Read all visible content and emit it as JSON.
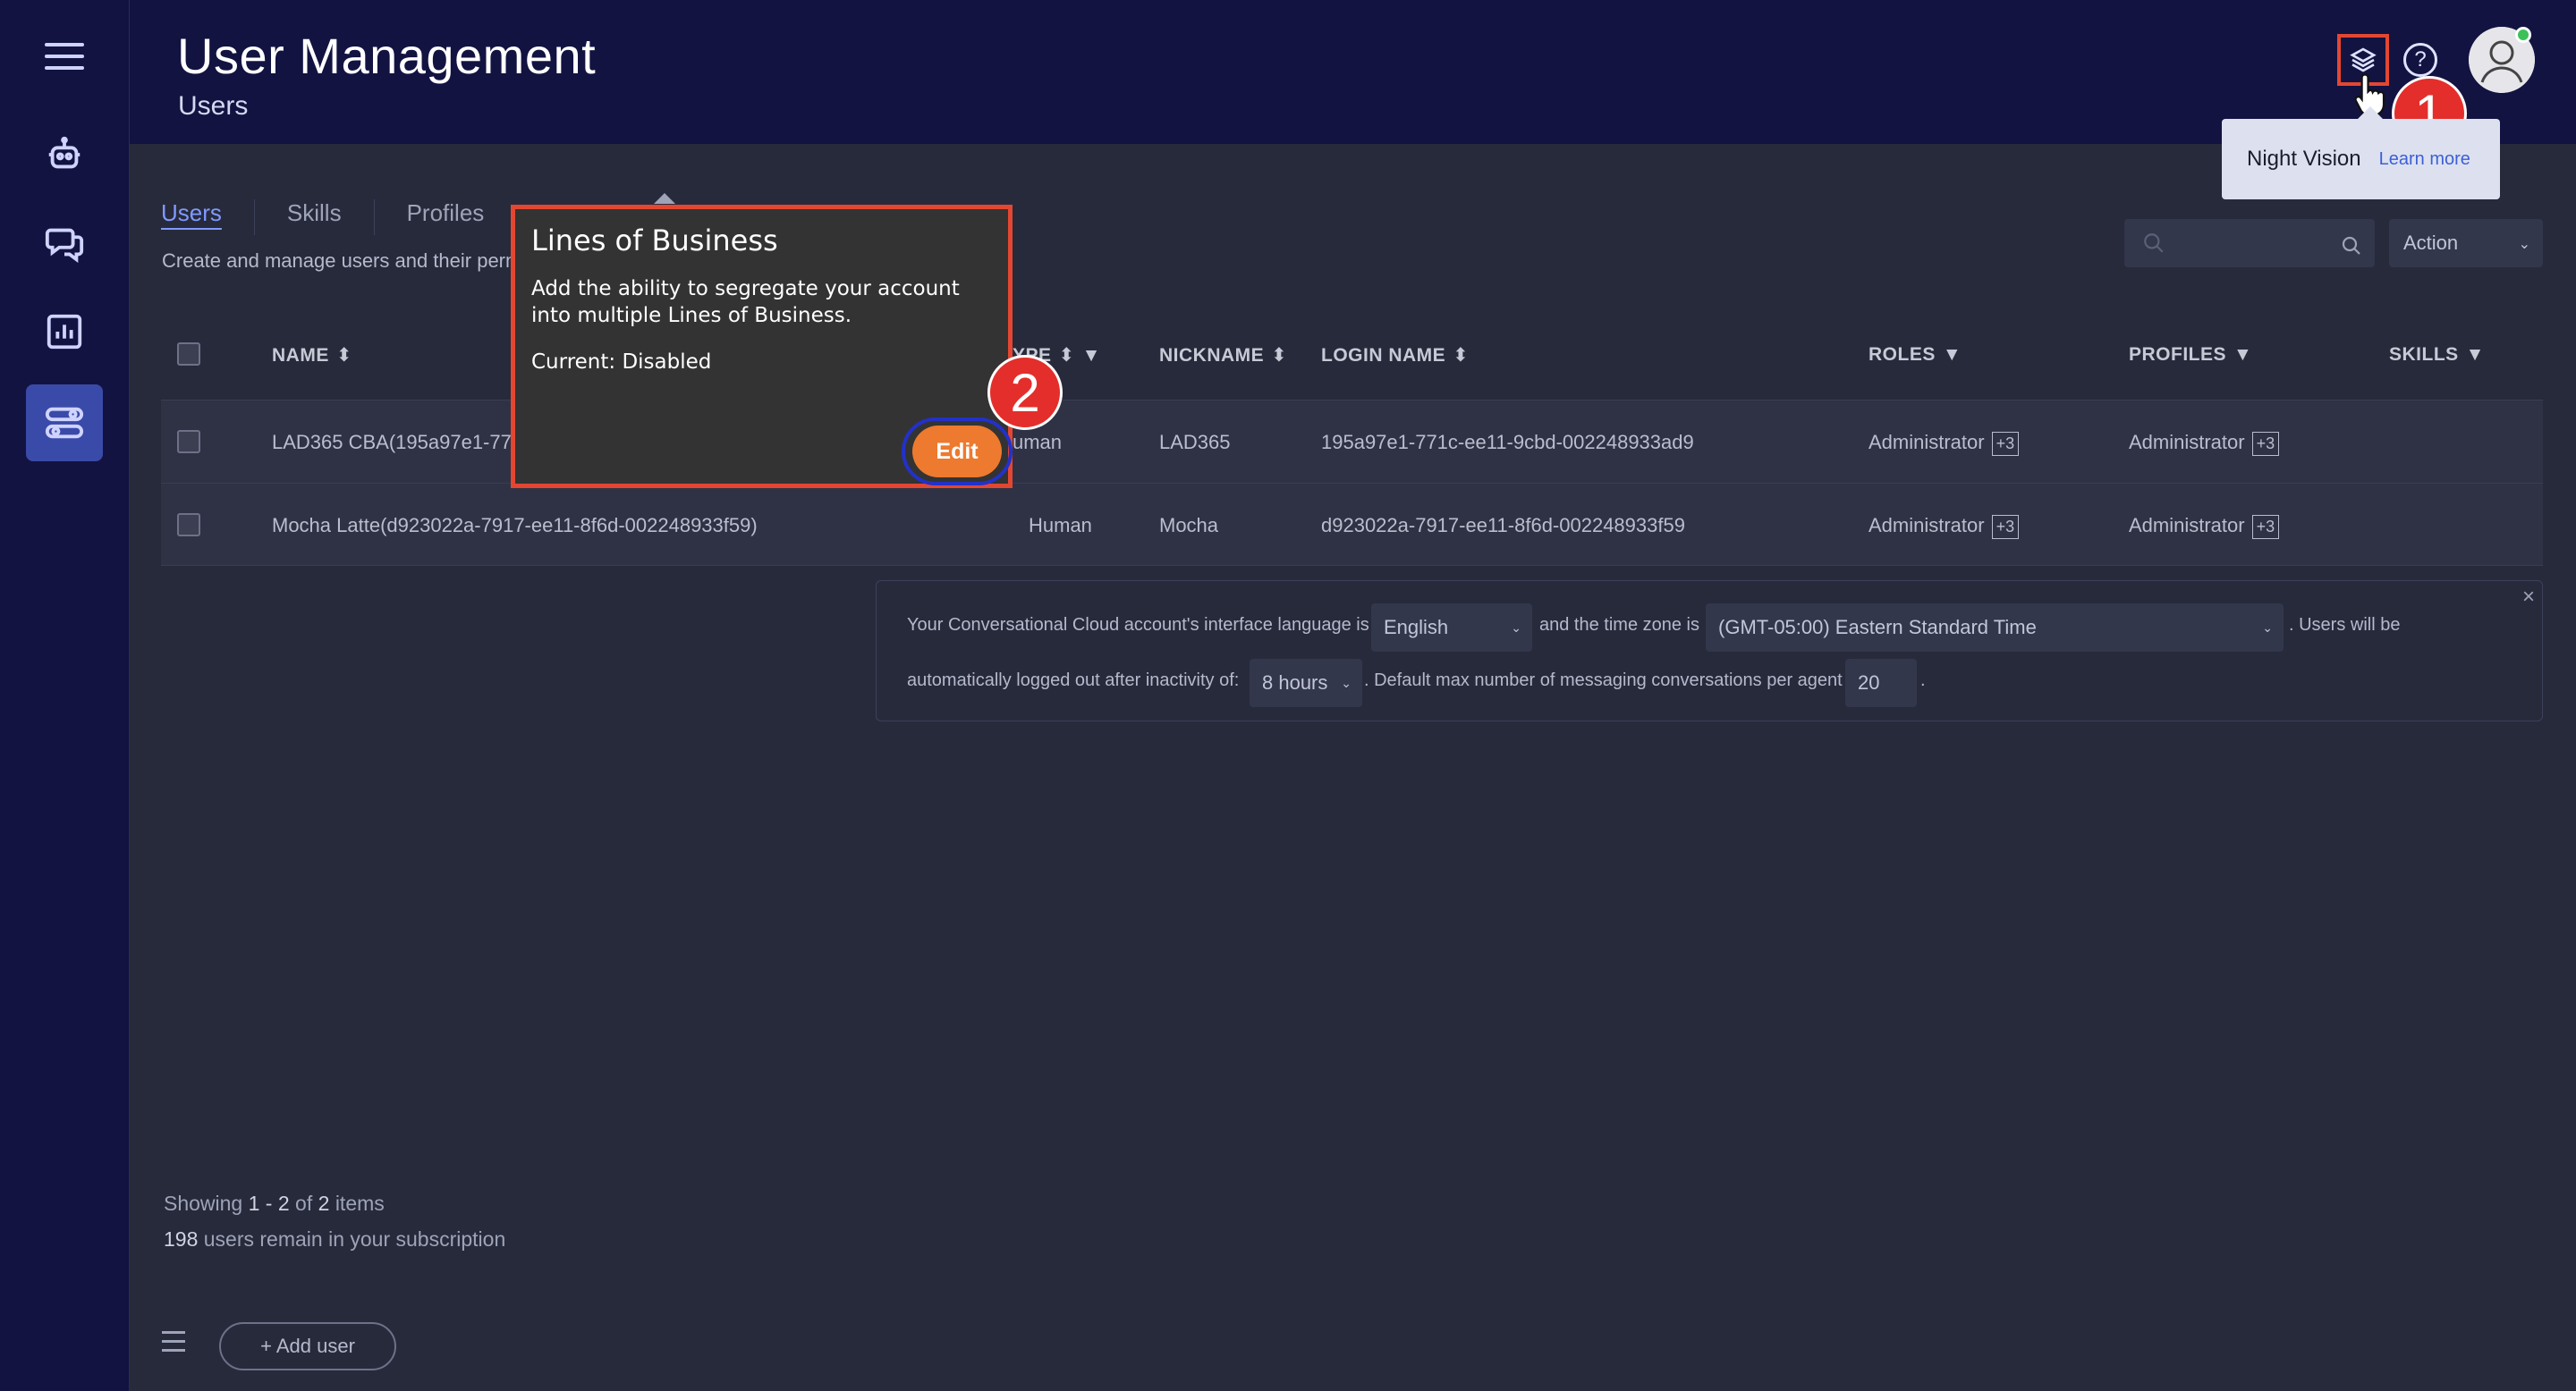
{
  "header": {
    "title": "User Management",
    "subtitle": "Users"
  },
  "night_vision": {
    "label": "Night Vision",
    "link": "Learn more"
  },
  "callouts": [
    "1",
    "2"
  ],
  "tabs": [
    {
      "label": "Users"
    },
    {
      "label": "Skills"
    },
    {
      "label": "Profiles"
    }
  ],
  "tab_description": "Create and manage users and their perm",
  "action": {
    "label": "Action",
    "chevron": "⌄"
  },
  "table": {
    "headers": {
      "name": "NAME",
      "type": "YPE",
      "nickname": "NICKNAME",
      "login_name": "LOGIN NAME",
      "roles": "ROLES",
      "profiles": "PROFILES",
      "skills": "SKILLS"
    },
    "rows": [
      {
        "name": "LAD365 CBA(195a97e1-771",
        "type": "uman",
        "nickname": "LAD365",
        "login_name": "195a97e1-771c-ee11-9cbd-002248933ad9",
        "roles": "Administrator",
        "roles_more": "+3",
        "profiles": "Administrator",
        "profiles_more": "+3"
      },
      {
        "name": "Mocha Latte(d923022a-7917-ee11-8f6d-002248933f59)",
        "type": "Human",
        "nickname": "Mocha",
        "login_name": "d923022a-7917-ee11-8f6d-002248933f59",
        "roles": "Administrator",
        "roles_more": "+3",
        "profiles": "Administrator",
        "profiles_more": "+3"
      }
    ]
  },
  "settings": {
    "text_language": "Your Conversational Cloud account's interface language is",
    "language": "English",
    "text_timezone": "and the time zone is",
    "timezone": "(GMT-05:00) Eastern Standard Time",
    "text_users_will_be": ". Users will be",
    "text_logout": "automatically logged out after inactivity of:",
    "inactivity": "8 hours",
    "text_max_conv": ". Default max number of messaging conversations per agent",
    "max_conversations": "20",
    "text_period": ".",
    "close": "×"
  },
  "footer": {
    "showing_prefix": "Showing",
    "showing_range": "1 - 2",
    "showing_of": "of",
    "showing_total": "2",
    "showing_suffix": "items",
    "users_remaining": "198",
    "users_remaining_suffix": "users remain in your subscription",
    "add_user": "+ Add user"
  },
  "lob_popup": {
    "title": "Lines of Business",
    "description": "Add the ability to segregate your account into multiple Lines of Business.",
    "current": "Current: Disabled",
    "edit": "Edit"
  },
  "icons": {
    "sort": "⬍",
    "filter": "▼",
    "help": "?"
  },
  "colors": {
    "header_bg": "#121341",
    "accent_link": "#7f9aff",
    "highlight_border": "#e34732",
    "edit_button": "#ed7a2e",
    "callout_badge": "#e42e2b"
  }
}
